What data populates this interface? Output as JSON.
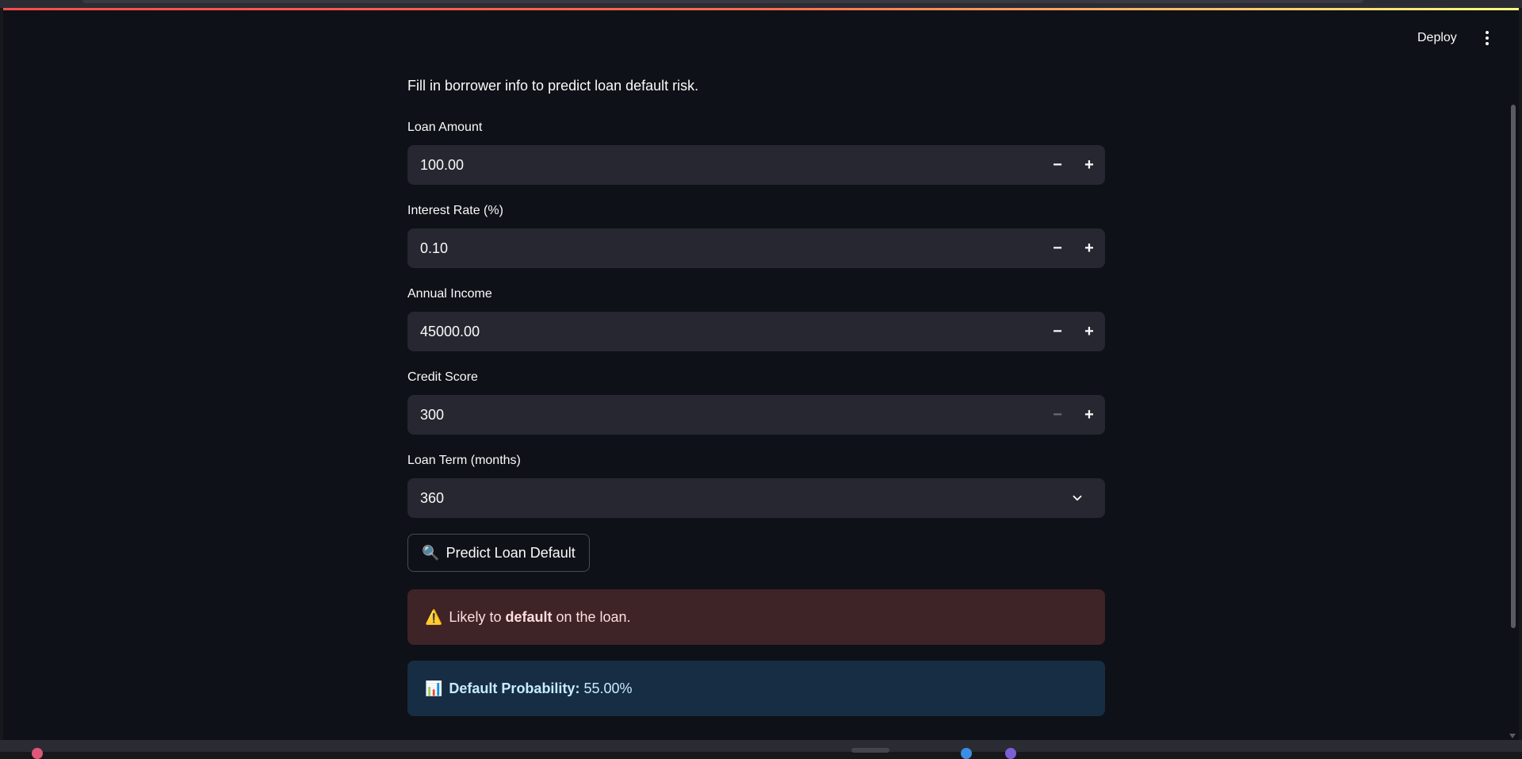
{
  "header": {
    "deploy_label": "Deploy",
    "menu_icon": "more-vertical-icon"
  },
  "intro_text": "Fill in borrower info to predict loan default risk.",
  "fields": [
    {
      "label": "Loan Amount",
      "value": "100.00",
      "minus_disabled": false
    },
    {
      "label": "Interest Rate (%)",
      "value": "0.10",
      "minus_disabled": false
    },
    {
      "label": "Annual Income",
      "value": "45000.00",
      "minus_disabled": false
    },
    {
      "label": "Credit Score",
      "value": "300",
      "minus_disabled": true
    }
  ],
  "stepper": {
    "minus": "−",
    "plus": "+"
  },
  "term_select": {
    "label": "Loan Term (months)",
    "selected": "360",
    "icon": "chevron-down-icon"
  },
  "predict_button": {
    "icon": "magnifying-glass-emoji",
    "icon_glyph": "🔍",
    "label": "Predict Loan Default"
  },
  "result_error": {
    "icon_glyph": "⚠️",
    "text_before": "Likely to ",
    "text_bold": "default",
    "text_after": " on the loan."
  },
  "result_info": {
    "icon_glyph": "📊",
    "label_bold": "Default Probability:",
    "value": " 55.00%"
  },
  "colors": {
    "background": "#0e1117",
    "input_bg": "#262730",
    "error_bg": "#3e2327",
    "info_bg": "#172d43",
    "accent_gradient_start": "#ff4b4b",
    "accent_gradient_end": "#fffd80"
  }
}
